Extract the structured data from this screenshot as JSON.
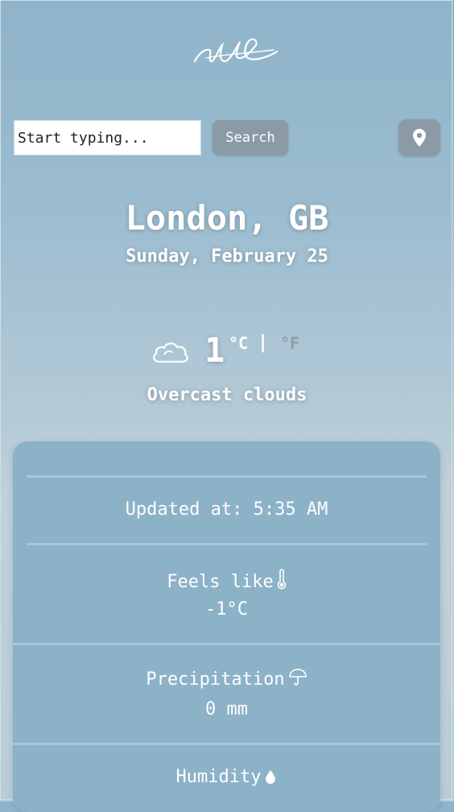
{
  "search": {
    "placeholder": "Start typing...",
    "button_label": "Search"
  },
  "location": {
    "city": "London, GB",
    "date": "Sunday, February 25"
  },
  "current": {
    "temperature": "1",
    "unit_c": "°C",
    "separator": "|",
    "unit_f": "°F",
    "description": "Overcast clouds",
    "icon": "cloud-icon"
  },
  "details": {
    "updated": "Updated at: 5:35 AM",
    "feels_like_label": "Feels like",
    "feels_like_value": "-1°C",
    "precipitation_label": "Precipitation",
    "precipitation_value": "0 mm",
    "humidity_label": "Humidity"
  },
  "icons": {
    "logo": "logo-icon",
    "location": "location-pin-icon",
    "thermometer": "thermometer-icon",
    "umbrella": "umbrella-icon",
    "drop": "water-drop-icon"
  },
  "colors": {
    "button": "#8a9ba6",
    "panel": "#8cb2c8",
    "inactive_unit": "#8e9ea8"
  }
}
